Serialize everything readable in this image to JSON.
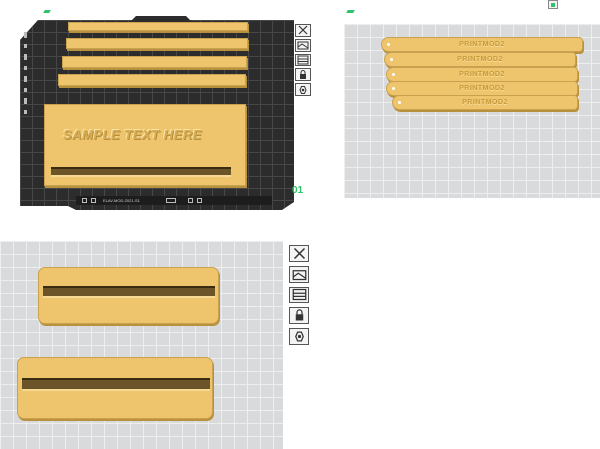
{
  "panel1": {
    "sample_text": "SAMPLE TEXT HERE",
    "layer_counter": "01",
    "status_text": "ELAV-MOD-2021-S1",
    "accent_color": "#2ec36a"
  },
  "panel2": {
    "tags": [
      "PRINTMOD2",
      "PRINTMOD2",
      "PRINTMOD2",
      "PRINTMOD2",
      "PRINTMOD2"
    ]
  },
  "icons": {
    "tool1": "close-icon",
    "tool2": "scene-icon",
    "tool3": "layers-icon",
    "tool4": "lock-icon",
    "tool5": "gear-icon"
  },
  "colors": {
    "plate": "#eec56d",
    "bed_dark": "#2c2c2c",
    "bed_light": "#d9dadb"
  }
}
